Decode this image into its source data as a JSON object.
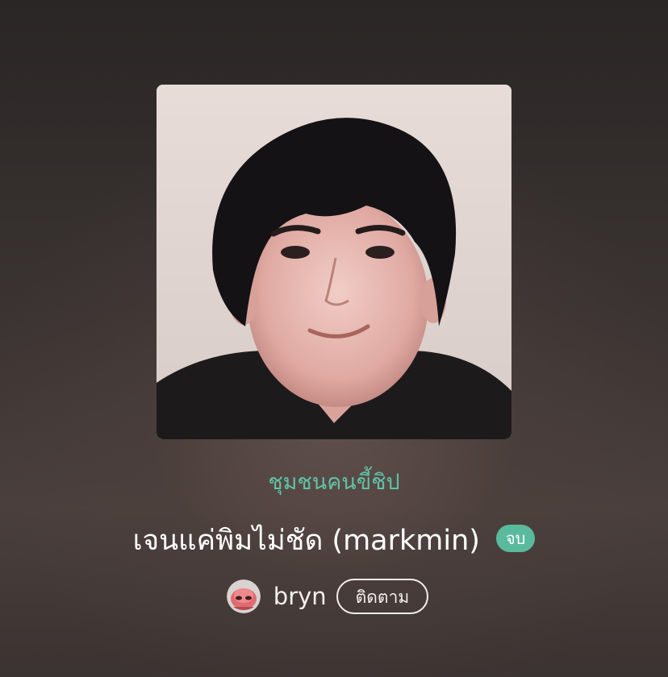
{
  "story": {
    "category": "ชุมชนคนขี้ชิป",
    "title": "เจนแค่พิมไม่ชัด (markmin)",
    "status_badge": "จบ"
  },
  "author": {
    "name": "bryn",
    "follow_label": "ติดตาม",
    "avatar_icon": "pink-creature-avatar"
  },
  "colors": {
    "accent_green": "#5aba9e",
    "category_text": "#5fc2a6"
  }
}
